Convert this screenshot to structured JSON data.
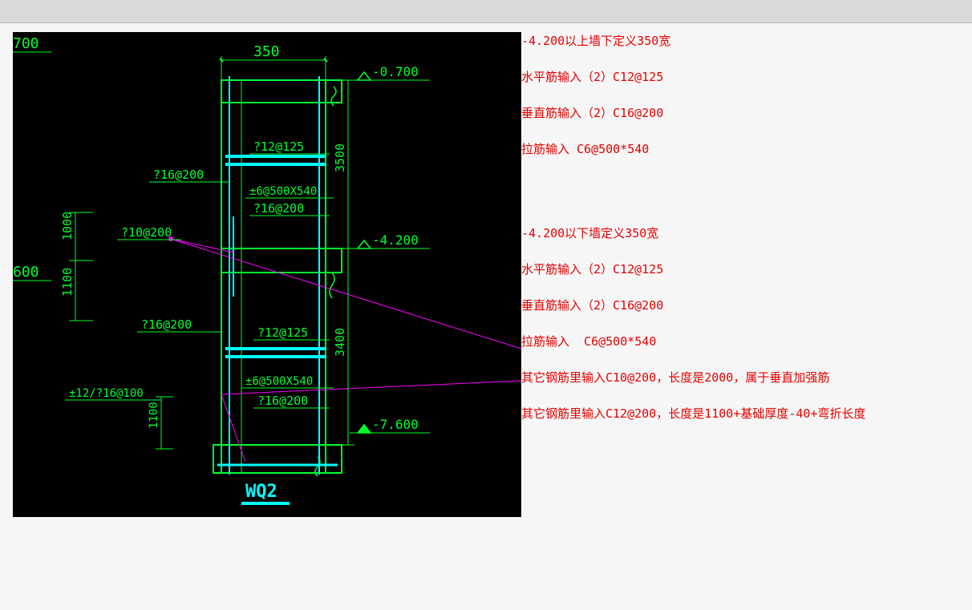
{
  "diagram": {
    "title": "WQ2",
    "dimensions": {
      "top_left_700": "700",
      "left_600": "600",
      "wall_width": "350",
      "left_span_1000": "1000",
      "left_span_1100": "1100",
      "bottom_span_1100": "1100",
      "right_height_upper_3500": "3500",
      "right_height_lower_3400": "3400"
    },
    "elevations": {
      "top": "-0.700",
      "mid": "-4.200",
      "bottom": "-7.600"
    },
    "callouts": {
      "upper_h_bar": "?12@125",
      "upper_v_bar": "?16@200",
      "upper_tie": "±6@500X540",
      "upper_v_bar2": "?16@200",
      "mid_extra": "?10@200",
      "lower_h_bar_side": "?16@200",
      "lower_h_bar": "?12@125",
      "lower_tie": "±6@500X540",
      "lower_v_bar": "?16@200",
      "bottom_extra": "±12/?16@100"
    }
  },
  "notes": {
    "section1": {
      "heading": "-4.200以上墙下定义350宽",
      "hbar": "水平筋输入（2）C12@125",
      "vbar": "垂直筋输入（2）C16@200",
      "tie": "拉筋输入 C6@500*540"
    },
    "section2": {
      "heading": "-4.200以下墙定义350宽",
      "hbar": "水平筋输入（2）C12@125",
      "vbar": "垂直筋输入（2）C16@200",
      "tie": "拉筋输入  C6@500*540",
      "extra1": "其它钢筋里输入C10@200，长度是2000，属于垂直加强筋",
      "extra2": "其它钢筋里输入C12@200，长度是1100+基础厚度-40+弯折长度"
    }
  }
}
